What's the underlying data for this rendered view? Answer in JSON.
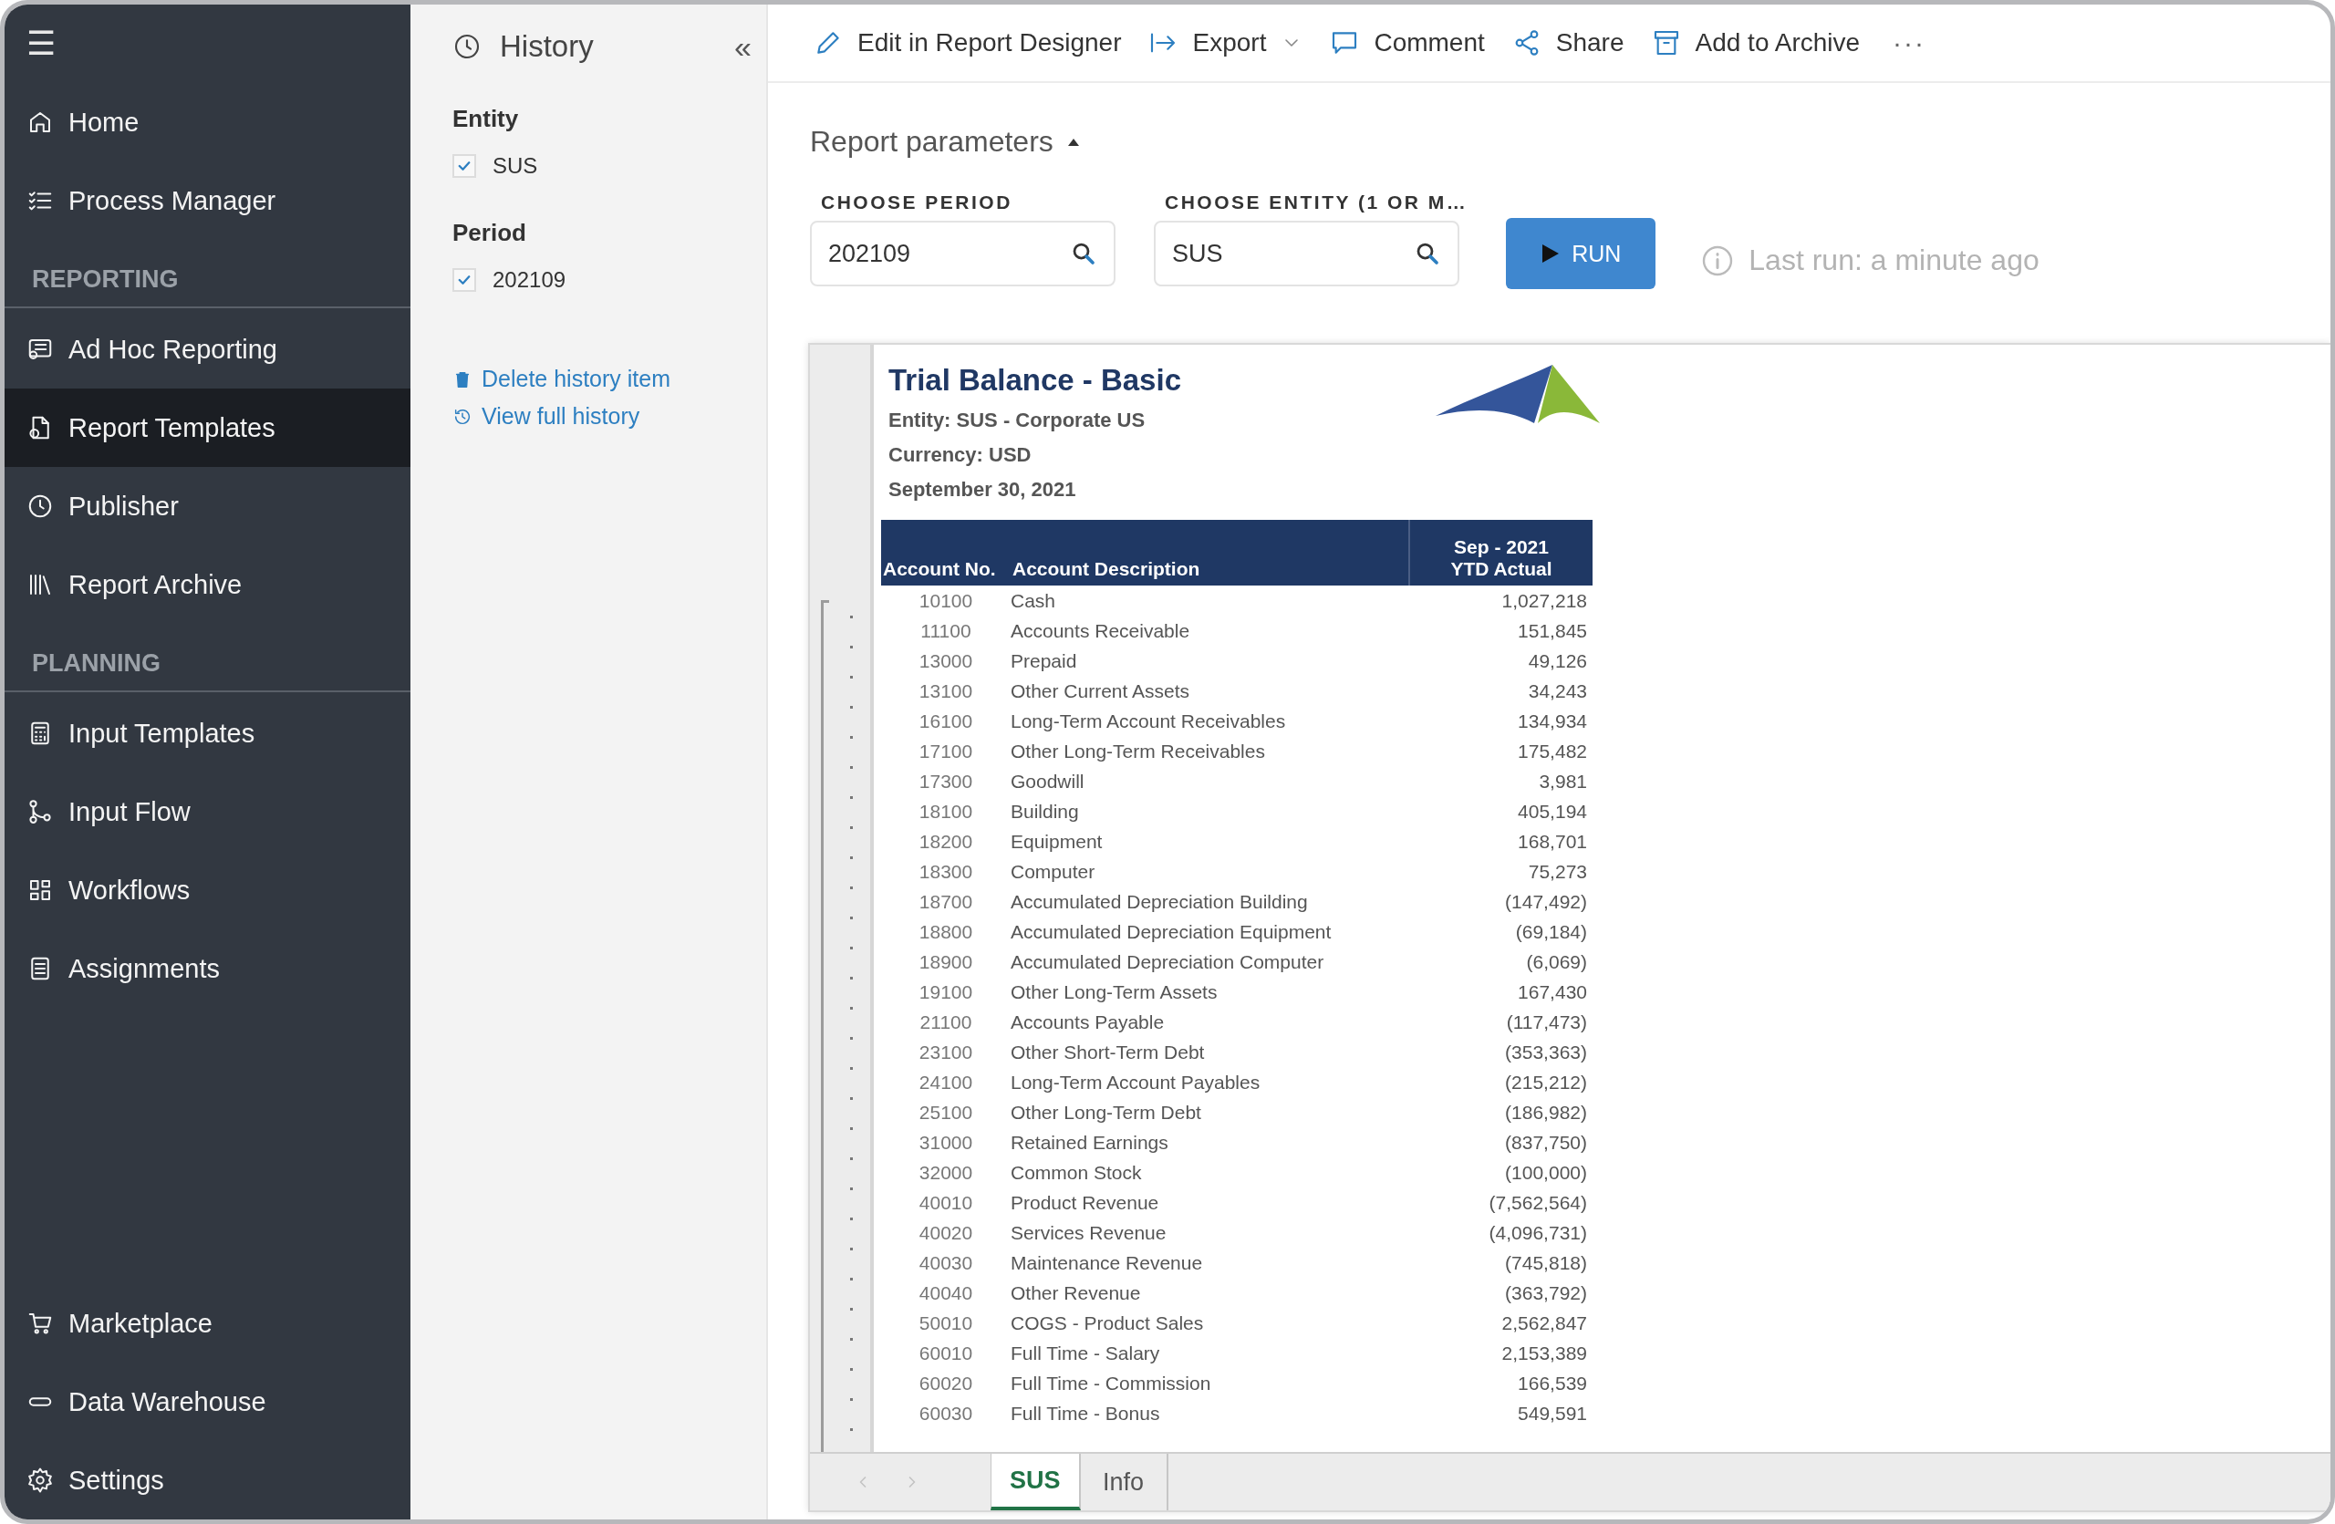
{
  "sidebar": {
    "menu_label": "☰",
    "items": [
      {
        "kind": "item",
        "label": "Home",
        "selected": false
      },
      {
        "kind": "item",
        "label": "Process Manager",
        "selected": false
      },
      {
        "kind": "heading",
        "label": "REPORTING"
      },
      {
        "kind": "item",
        "label": "Ad Hoc Reporting",
        "selected": false
      },
      {
        "kind": "item",
        "label": "Report Templates",
        "selected": true
      },
      {
        "kind": "item",
        "label": "Publisher",
        "selected": false
      },
      {
        "kind": "item",
        "label": "Report Archive",
        "selected": false
      },
      {
        "kind": "heading",
        "label": "PLANNING"
      },
      {
        "kind": "item",
        "label": "Input Templates",
        "selected": false
      },
      {
        "kind": "item",
        "label": "Input Flow",
        "selected": false
      },
      {
        "kind": "item",
        "label": "Workflows",
        "selected": false
      },
      {
        "kind": "item",
        "label": "Assignments",
        "selected": false
      }
    ],
    "bottom_items": [
      {
        "label": "Marketplace",
        "selected": false
      },
      {
        "label": "Data Warehouse",
        "selected": false
      },
      {
        "label": "Settings",
        "selected": false
      }
    ]
  },
  "history": {
    "title": "History",
    "collapse": "«",
    "groups": [
      {
        "label": "Entity",
        "options": [
          {
            "label": "SUS",
            "checked": true
          }
        ]
      },
      {
        "label": "Period",
        "options": [
          {
            "label": "202109",
            "checked": true
          }
        ]
      }
    ],
    "links": [
      "Delete history item",
      "View full history"
    ]
  },
  "toolbar": {
    "actions": [
      {
        "label": "Edit in Report Designer",
        "dropdown": false
      },
      {
        "label": "Export",
        "dropdown": true
      },
      {
        "label": "Comment",
        "dropdown": false
      },
      {
        "label": "Share",
        "dropdown": false
      },
      {
        "label": "Add to Archive",
        "dropdown": false
      }
    ],
    "more": "···"
  },
  "parameters": {
    "title": "Report parameters",
    "expanded": true,
    "fields": [
      {
        "label": "CHOOSE PERIOD",
        "value": "202109"
      },
      {
        "label": "CHOOSE ENTITY (1 OR M…",
        "value": "SUS"
      }
    ],
    "run_button": "RUN",
    "last_run": "Last run: a minute ago"
  },
  "report": {
    "title": "Trial Balance - Basic",
    "subtitles": [
      "Entity: SUS - Corporate US",
      "Currency: USD",
      "September 30, 2021"
    ],
    "columns": [
      "Account No.",
      "Account Description",
      "Sep - 2021",
      "YTD Actual"
    ],
    "rows": [
      [
        "10100",
        "Cash",
        "1,027,218"
      ],
      [
        "11100",
        "Accounts Receivable",
        "151,845"
      ],
      [
        "13000",
        "Prepaid",
        "49,126"
      ],
      [
        "13100",
        "Other Current Assets",
        "34,243"
      ],
      [
        "16100",
        "Long-Term Account Receivables",
        "134,934"
      ],
      [
        "17100",
        "Other Long-Term Receivables",
        "175,482"
      ],
      [
        "17300",
        "Goodwill",
        "3,981"
      ],
      [
        "18100",
        "Building",
        "405,194"
      ],
      [
        "18200",
        "Equipment",
        "168,701"
      ],
      [
        "18300",
        "Computer",
        "75,273"
      ],
      [
        "18700",
        "Accumulated Depreciation Building",
        "(147,492)"
      ],
      [
        "18800",
        "Accumulated Depreciation Equipment",
        "(69,184)"
      ],
      [
        "18900",
        "Accumulated Depreciation Computer",
        "(6,069)"
      ],
      [
        "19100",
        "Other Long-Term Assets",
        "167,430"
      ],
      [
        "21100",
        "Accounts Payable",
        "(117,473)"
      ],
      [
        "23100",
        "Other Short-Term Debt",
        "(353,363)"
      ],
      [
        "24100",
        "Long-Term Account Payables",
        "(215,212)"
      ],
      [
        "25100",
        "Other Long-Term Debt",
        "(186,982)"
      ],
      [
        "31000",
        "Retained Earnings",
        "(837,750)"
      ],
      [
        "32000",
        "Common Stock",
        "(100,000)"
      ],
      [
        "40010",
        "Product Revenue",
        "(7,562,564)"
      ],
      [
        "40020",
        "Services Revenue",
        "(4,096,731)"
      ],
      [
        "40030",
        "Maintenance Revenue",
        "(745,818)"
      ],
      [
        "40040",
        "Other Revenue",
        "(363,792)"
      ],
      [
        "50010",
        "COGS - Product Sales",
        "2,562,847"
      ],
      [
        "60010",
        "Full Time - Salary",
        "2,153,389"
      ],
      [
        "60020",
        "Full Time - Commission",
        "166,539"
      ],
      [
        "60030",
        "Full Time - Bonus",
        "549,591"
      ]
    ],
    "sheet_tabs": [
      {
        "label": "SUS",
        "selected": true
      },
      {
        "label": "Info",
        "selected": false
      }
    ]
  }
}
